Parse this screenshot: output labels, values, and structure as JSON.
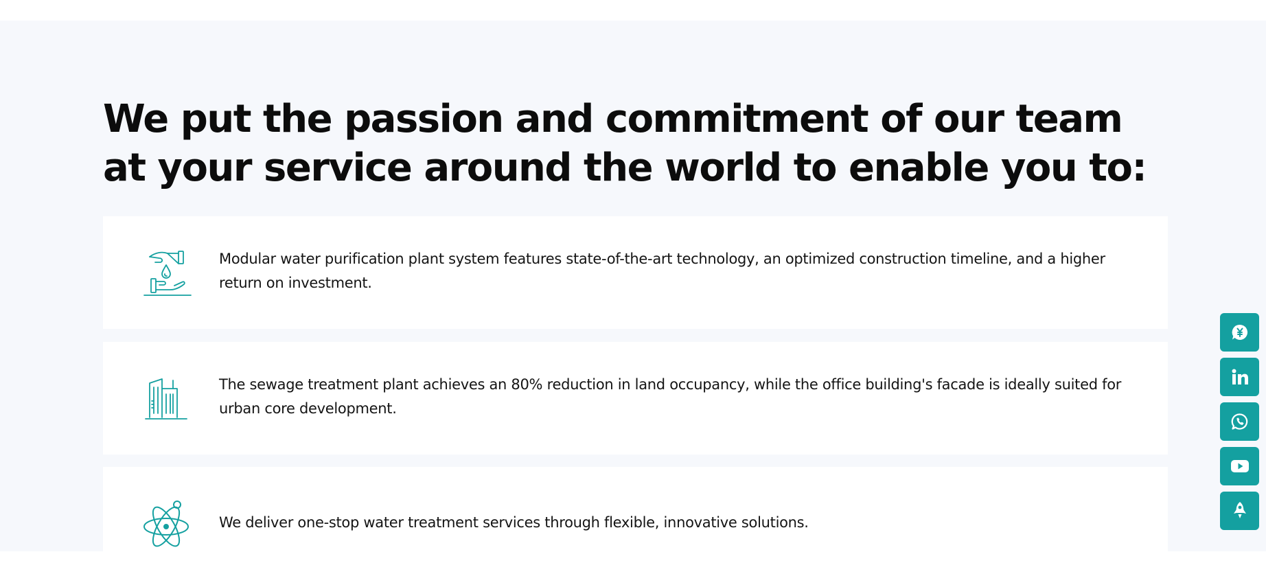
{
  "headline": "We put the passion and commitment of our team at your service around the world to enable you to:",
  "accent_color": "#14a0a0",
  "features": [
    {
      "icon": "water-hands-icon",
      "text": "Modular water purification plant system features state-of-the-art technology, an optimized construction timeline, and a higher return on investment."
    },
    {
      "icon": "building-icon",
      "text": "The sewage treatment plant achieves an 80% reduction in land occupancy, while the office building's facade is ideally suited for urban core development."
    },
    {
      "icon": "atom-icon",
      "text": "We deliver one-stop water treatment services through flexible, innovative solutions."
    }
  ],
  "social_rail": [
    {
      "icon": "quote-chat-icon"
    },
    {
      "icon": "linkedin-icon"
    },
    {
      "icon": "whatsapp-icon"
    },
    {
      "icon": "youtube-icon"
    },
    {
      "icon": "rocket-top-icon"
    }
  ]
}
